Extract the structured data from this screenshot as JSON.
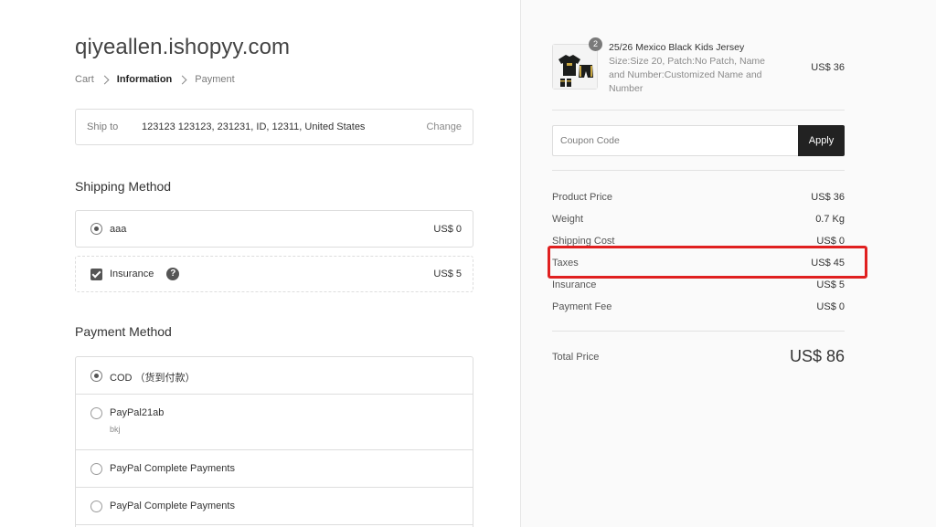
{
  "store": {
    "name": "qiyeallen.ishopyy.com"
  },
  "breadcrumb": {
    "items": [
      "Cart",
      "Information",
      "Payment"
    ]
  },
  "ship_to": {
    "label": "Ship to",
    "address": "123123 123123, 231231, ID, 12311, United States",
    "change_label": "Change"
  },
  "shipping_method": {
    "title": "Shipping Method",
    "options": [
      {
        "label": "aaa",
        "price": "US$ 0",
        "selected": true
      },
      {
        "label": "Insurance",
        "price": "US$ 5",
        "checked": true
      }
    ]
  },
  "payment_method": {
    "title": "Payment Method",
    "options": [
      {
        "label": "COD （货到付款）",
        "sub": "",
        "selected": true
      },
      {
        "label": "PayPal21ab",
        "sub": "bkj",
        "selected": false
      },
      {
        "label": "PayPal Complete Payments",
        "sub": "",
        "selected": false
      },
      {
        "label": "PayPal Complete Payments",
        "sub": "",
        "selected": false
      }
    ]
  },
  "cart": {
    "items": [
      {
        "quantity": "2",
        "title": "25/26 Mexico Black Kids Jersey",
        "variant": "Size:Size 20, Patch:No Patch, Name and Number:Customized Name and Number",
        "price": "US$ 36"
      }
    ]
  },
  "coupon": {
    "placeholder": "Coupon Code",
    "apply_label": "Apply"
  },
  "summary": {
    "rows": [
      {
        "label": "Product Price",
        "value": "US$ 36"
      },
      {
        "label": "Weight",
        "value": "0.7 Kg"
      },
      {
        "label": "Shipping Cost",
        "value": "US$ 0"
      },
      {
        "label": "Taxes",
        "value": "US$ 45"
      },
      {
        "label": "Insurance",
        "value": "US$ 5"
      },
      {
        "label": "Payment Fee",
        "value": "US$ 0"
      }
    ],
    "total_label": "Total Price",
    "total_value": "US$ 86"
  },
  "colors": {
    "highlight": "#e02020",
    "apply_button": "#222222",
    "right_panel_bg": "#fafafa"
  }
}
